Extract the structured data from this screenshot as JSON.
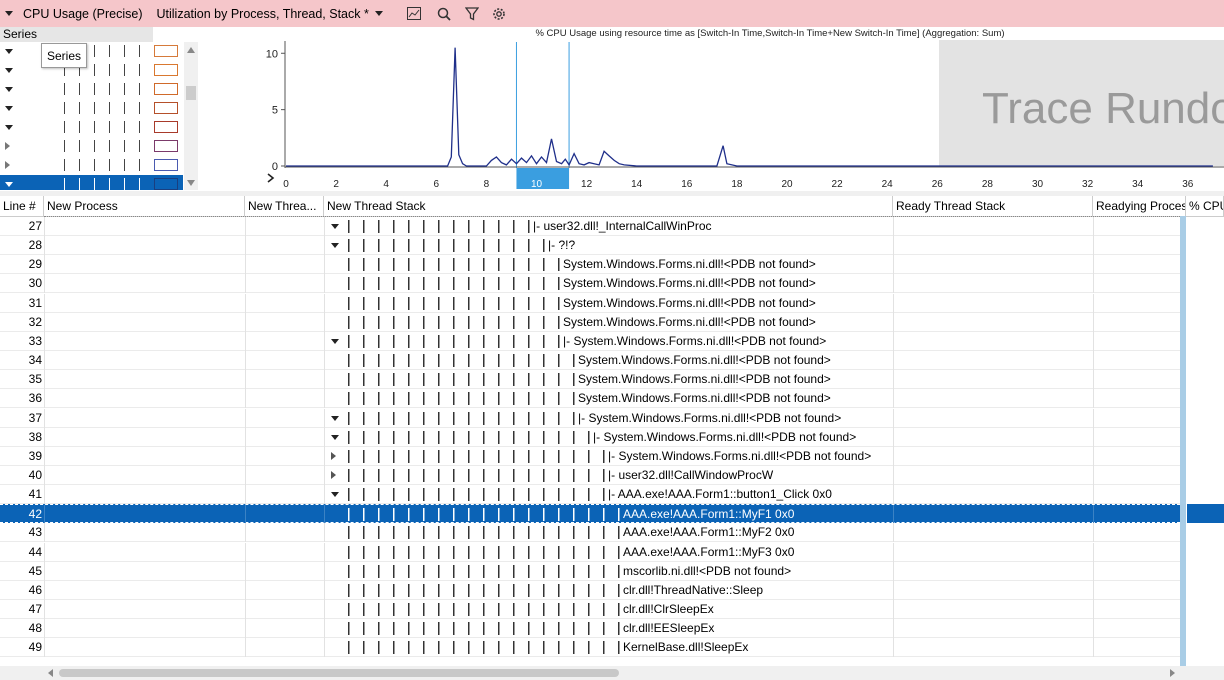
{
  "toolbar": {
    "preset": "CPU Usage (Precise)",
    "view": "Utilization by Process, Thread, Stack *",
    "icons": [
      "chart-type-icon",
      "search-icon",
      "filter-icon",
      "settings-icon"
    ]
  },
  "series_panel": {
    "header": "Series",
    "tooltip": "Series",
    "rows": [
      {
        "expanded": true,
        "color": "#d67a3a"
      },
      {
        "expanded": true,
        "color": "#d9782f"
      },
      {
        "expanded": true,
        "color": "#d06a2a"
      },
      {
        "expanded": true,
        "color": "#b5502a"
      },
      {
        "expanded": true,
        "color": "#a83a2a"
      },
      {
        "expanded": false,
        "color": "#7b3a6a"
      },
      {
        "expanded": false,
        "color": "#4a5ab0"
      },
      {
        "expanded": true,
        "color": "#1a3f80",
        "selected": true
      }
    ]
  },
  "chart_data": {
    "type": "line",
    "title": "% CPU Usage using resource time as [Switch-In Time,Switch-In Time+New Switch-In Time] (Aggregation: Sum)",
    "xlim": [
      0,
      37
    ],
    "ylim": [
      0,
      11
    ],
    "xticks": [
      "0",
      "2",
      "4",
      "6",
      "8",
      "10",
      "12",
      "14",
      "16",
      "18",
      "20",
      "22",
      "24",
      "26",
      "28",
      "30",
      "32",
      "34",
      "36"
    ],
    "yticks": [
      "10",
      "5",
      "0"
    ],
    "selection_range": [
      9.2,
      11.3
    ],
    "overlay_text": "Trace Rundo",
    "series": [
      {
        "color": "#1f2f8a",
        "x": [
          0,
          6.45,
          6.6,
          6.75,
          6.9,
          7.05,
          7.2,
          7.4,
          8.0,
          8.2,
          8.4,
          8.6,
          8.8,
          9.0,
          9.2,
          9.4,
          9.6,
          9.8,
          10.0,
          10.2,
          10.4,
          10.6,
          10.8,
          11.0,
          11.15,
          11.3,
          11.5,
          11.7,
          11.9,
          12.1,
          12.3,
          12.5,
          12.7,
          12.9,
          13.1,
          13.3,
          13.5,
          14.0,
          17.2,
          17.45,
          17.6,
          18.0,
          37
        ],
        "y": [
          0,
          0,
          0.8,
          10.5,
          1.0,
          0.2,
          0,
          0,
          0,
          0.5,
          0.8,
          0.3,
          0.1,
          0.6,
          0.2,
          0.7,
          0.3,
          0.9,
          0.2,
          0.8,
          0.3,
          2.4,
          0.4,
          0.2,
          0.6,
          0.1,
          1.1,
          0.2,
          0.1,
          0.3,
          0.2,
          0.1,
          1.3,
          0.9,
          0.5,
          0.2,
          0.1,
          0,
          0,
          1.8,
          0.2,
          0,
          0
        ]
      }
    ]
  },
  "table": {
    "columns": [
      "Line #",
      "New Process",
      "New Threa...",
      "New Thread Stack",
      "Ready Thread Stack",
      "Readying Proces",
      "% CPU"
    ],
    "rows": [
      {
        "line": "27",
        "toggle": "open",
        "depth": 13,
        "text": "|- user32.dll!_InternalCallWinProc"
      },
      {
        "line": "28",
        "toggle": "open",
        "depth": 14,
        "text": "|- ?!?"
      },
      {
        "line": "29",
        "toggle": "none",
        "depth": 15,
        "text": "System.Windows.Forms.ni.dll!<PDB not found>"
      },
      {
        "line": "30",
        "toggle": "none",
        "depth": 15,
        "text": "System.Windows.Forms.ni.dll!<PDB not found>"
      },
      {
        "line": "31",
        "toggle": "none",
        "depth": 15,
        "text": "System.Windows.Forms.ni.dll!<PDB not found>"
      },
      {
        "line": "32",
        "toggle": "none",
        "depth": 15,
        "text": "System.Windows.Forms.ni.dll!<PDB not found>"
      },
      {
        "line": "33",
        "toggle": "open",
        "depth": 15,
        "text": "|- System.Windows.Forms.ni.dll!<PDB not found>"
      },
      {
        "line": "34",
        "toggle": "none",
        "depth": 16,
        "text": "System.Windows.Forms.ni.dll!<PDB not found>"
      },
      {
        "line": "35",
        "toggle": "none",
        "depth": 16,
        "text": "System.Windows.Forms.ni.dll!<PDB not found>"
      },
      {
        "line": "36",
        "toggle": "none",
        "depth": 16,
        "text": "System.Windows.Forms.ni.dll!<PDB not found>"
      },
      {
        "line": "37",
        "toggle": "open",
        "depth": 16,
        "text": "|- System.Windows.Forms.ni.dll!<PDB not found>"
      },
      {
        "line": "38",
        "toggle": "open",
        "depth": 17,
        "text": "|- System.Windows.Forms.ni.dll!<PDB not found>"
      },
      {
        "line": "39",
        "toggle": "closed",
        "depth": 18,
        "text": "|- System.Windows.Forms.ni.dll!<PDB not found>"
      },
      {
        "line": "40",
        "toggle": "closed",
        "depth": 18,
        "text": "|- user32.dll!CallWindowProcW"
      },
      {
        "line": "41",
        "toggle": "open",
        "depth": 18,
        "text": "|- AAA.exe!AAA.Form1::button1_Click 0x0"
      },
      {
        "line": "42",
        "toggle": "none",
        "depth": 19,
        "text": "AAA.exe!AAA.Form1::MyF1 0x0",
        "selected": true
      },
      {
        "line": "43",
        "toggle": "none",
        "depth": 19,
        "text": "AAA.exe!AAA.Form1::MyF2 0x0"
      },
      {
        "line": "44",
        "toggle": "none",
        "depth": 19,
        "text": "AAA.exe!AAA.Form1::MyF3 0x0"
      },
      {
        "line": "45",
        "toggle": "none",
        "depth": 19,
        "text": "mscorlib.ni.dll!<PDB not found>"
      },
      {
        "line": "46",
        "toggle": "none",
        "depth": 19,
        "text": "clr.dll!ThreadNative::Sleep"
      },
      {
        "line": "47",
        "toggle": "none",
        "depth": 19,
        "text": "clr.dll!ClrSleepEx"
      },
      {
        "line": "48",
        "toggle": "none",
        "depth": 19,
        "text": "clr.dll!EESleepEx"
      },
      {
        "line": "49",
        "toggle": "none",
        "depth": 19,
        "text": "KernelBase.dll!SleepEx"
      }
    ]
  }
}
